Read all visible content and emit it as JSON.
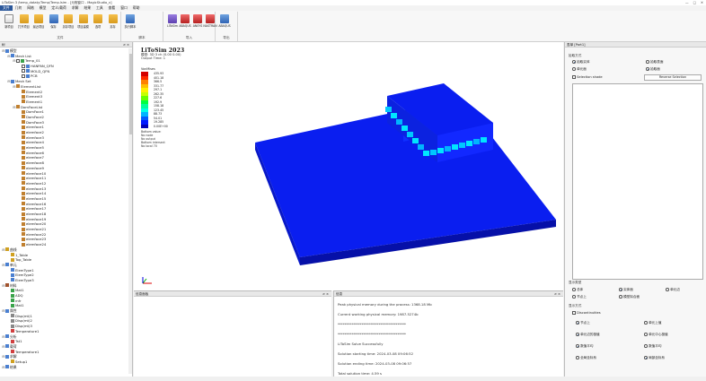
{
  "window": {
    "title": "LiToSim 3 /temp_dataty/Temp/Temp.lsim - [元程窗口 - MagicStudio_v]"
  },
  "menu": [
    "文件",
    "几何",
    "网格",
    "模型",
    "定义/载荷",
    "求解",
    "结果",
    "工具",
    "查看",
    "窗口",
    "帮助"
  ],
  "ribbon": {
    "groups": [
      {
        "label": "文件",
        "buttons": [
          "新项目",
          "打开项目",
          "最近项目",
          "保存",
          "另存项目",
          "项目建模",
          "选项",
          "另存"
        ]
      },
      {
        "label": "脚本",
        "buttons": [
          "执行脚本"
        ]
      },
      {
        "label": "导入",
        "buttons": [
          "LiToSim",
          "ABAQUS",
          "ANSYS",
          "NASTRAN"
        ]
      },
      {
        "label": "导出",
        "buttons": [
          "ABAQUS"
        ]
      }
    ]
  },
  "left_panel": {
    "title": "树",
    "pin": "≠ ×"
  },
  "tree": [
    {
      "d": 0,
      "t": "模型",
      "tw": "⊟",
      "icon": "#4a7fd0"
    },
    {
      "d": 1,
      "t": "Mesh List",
      "tw": "⊟",
      "icon": "#4a7fd0"
    },
    {
      "d": 2,
      "t": "Temp_01",
      "tw": "⊟",
      "icon": "#3aa34a",
      "chk": true
    },
    {
      "d": 3,
      "t": "HANPAN_QFN",
      "tw": "",
      "icon": "#4a7fd0",
      "chk": true
    },
    {
      "d": 3,
      "t": "MOLD_QFN",
      "tw": "",
      "icon": "#4a7fd0",
      "chk": true
    },
    {
      "d": 3,
      "t": "PCB",
      "tw": "",
      "icon": "#4a7fd0",
      "chk": true
    },
    {
      "d": 1,
      "t": "Mesh Set",
      "tw": "⊟",
      "icon": "#4a7fd0"
    },
    {
      "d": 2,
      "t": "ElementList",
      "tw": "⊟",
      "icon": "#c08030"
    },
    {
      "d": 3,
      "t": "Element2",
      "tw": "",
      "icon": "#c08030"
    },
    {
      "d": 3,
      "t": "Element3",
      "tw": "",
      "icon": "#c08030"
    },
    {
      "d": 3,
      "t": "Element1",
      "tw": "",
      "icon": "#c08030"
    },
    {
      "d": 2,
      "t": "DomFaceList",
      "tw": "⊟",
      "icon": "#c08030"
    },
    {
      "d": 3,
      "t": "DomFace1",
      "tw": "",
      "icon": "#c08030"
    },
    {
      "d": 3,
      "t": "DomFace2",
      "tw": "",
      "icon": "#c08030"
    },
    {
      "d": 3,
      "t": "DomFace3",
      "tw": "",
      "icon": "#c08030"
    },
    {
      "d": 3,
      "t": "elemface1",
      "tw": "",
      "icon": "#c08030"
    },
    {
      "d": 3,
      "t": "elemface2",
      "tw": "",
      "icon": "#c08030"
    },
    {
      "d": 3,
      "t": "elemface3",
      "tw": "",
      "icon": "#c08030"
    },
    {
      "d": 3,
      "t": "elemface4",
      "tw": "",
      "icon": "#c08030"
    },
    {
      "d": 3,
      "t": "elemface5",
      "tw": "",
      "icon": "#c08030"
    },
    {
      "d": 3,
      "t": "elemface6",
      "tw": "",
      "icon": "#c08030"
    },
    {
      "d": 3,
      "t": "elemface7",
      "tw": "",
      "icon": "#c08030"
    },
    {
      "d": 3,
      "t": "elemface8",
      "tw": "",
      "icon": "#c08030"
    },
    {
      "d": 3,
      "t": "elemface9",
      "tw": "",
      "icon": "#c08030"
    },
    {
      "d": 3,
      "t": "elemface10",
      "tw": "",
      "icon": "#c08030"
    },
    {
      "d": 3,
      "t": "elemface11",
      "tw": "",
      "icon": "#c08030"
    },
    {
      "d": 3,
      "t": "elemface12",
      "tw": "",
      "icon": "#c08030"
    },
    {
      "d": 3,
      "t": "elemface13",
      "tw": "",
      "icon": "#c08030"
    },
    {
      "d": 3,
      "t": "elemface14",
      "tw": "",
      "icon": "#c08030"
    },
    {
      "d": 3,
      "t": "elemface15",
      "tw": "",
      "icon": "#c08030"
    },
    {
      "d": 3,
      "t": "elemface16",
      "tw": "",
      "icon": "#c08030"
    },
    {
      "d": 3,
      "t": "elemface17",
      "tw": "",
      "icon": "#c08030"
    },
    {
      "d": 3,
      "t": "elemface18",
      "tw": "",
      "icon": "#c08030"
    },
    {
      "d": 3,
      "t": "elemface19",
      "tw": "",
      "icon": "#c08030"
    },
    {
      "d": 3,
      "t": "elemface20",
      "tw": "",
      "icon": "#c08030"
    },
    {
      "d": 3,
      "t": "elemface21",
      "tw": "",
      "icon": "#c08030"
    },
    {
      "d": 3,
      "t": "elemface22",
      "tw": "",
      "icon": "#c08030"
    },
    {
      "d": 3,
      "t": "elemface23",
      "tw": "",
      "icon": "#c08030"
    },
    {
      "d": 3,
      "t": "elemface24",
      "tw": "",
      "icon": "#c08030"
    },
    {
      "d": 0,
      "t": "曲线",
      "tw": "⊟",
      "icon": "#d0a020"
    },
    {
      "d": 1,
      "t": "1_Table",
      "tw": "",
      "icon": "#d0a020"
    },
    {
      "d": 1,
      "t": "Top_Table",
      "tw": "",
      "icon": "#d0a020"
    },
    {
      "d": 0,
      "t": "单元",
      "tw": "⊟",
      "icon": "#4a7fd0"
    },
    {
      "d": 1,
      "t": "ElemType1",
      "tw": "",
      "icon": "#4a7fd0"
    },
    {
      "d": 1,
      "t": "ElemType2",
      "tw": "",
      "icon": "#4a7fd0"
    },
    {
      "d": 1,
      "t": "ElemType3",
      "tw": "",
      "icon": "#4a7fd0"
    },
    {
      "d": 0,
      "t": "材料",
      "tw": "⊟",
      "icon": "#a0522d"
    },
    {
      "d": 1,
      "t": "Mat1",
      "tw": "",
      "icon": "#3aa34a"
    },
    {
      "d": 1,
      "t": "ADQ",
      "tw": "",
      "icon": "#3aa34a"
    },
    {
      "d": 1,
      "t": "mfr",
      "tw": "",
      "icon": "#3aa34a"
    },
    {
      "d": 1,
      "t": "Mat1",
      "tw": "",
      "icon": "#3aa34a"
    },
    {
      "d": 0,
      "t": "属性",
      "tw": "⊟",
      "icon": "#4a7fd0"
    },
    {
      "d": 1,
      "t": "Disp(mt)1",
      "tw": "",
      "icon": "#888"
    },
    {
      "d": 1,
      "t": "Disp(mt)2",
      "tw": "",
      "icon": "#888"
    },
    {
      "d": 1,
      "t": "Disp(mt)3",
      "tw": "",
      "icon": "#888"
    },
    {
      "d": 1,
      "t": "Temperature1",
      "tw": "",
      "icon": "#d04040"
    },
    {
      "d": 0,
      "t": "分析",
      "tw": "⊟",
      "icon": "#4a7fd0"
    },
    {
      "d": 1,
      "t": "Tst1",
      "tw": "",
      "icon": "#d04040"
    },
    {
      "d": 0,
      "t": "载荷",
      "tw": "⊟",
      "icon": "#4a7fd0"
    },
    {
      "d": 1,
      "t": "Temperature1",
      "tw": "",
      "icon": "#d04040"
    },
    {
      "d": 0,
      "t": "求解",
      "tw": "⊟",
      "icon": "#4a7fd0"
    },
    {
      "d": 1,
      "t": "Setup1",
      "tw": "",
      "icon": "#d0a020"
    },
    {
      "d": 0,
      "t": "结果",
      "tw": "⊟",
      "icon": "#4a7fd0"
    }
  ],
  "viewport": {
    "brand": "LiToSim 2023",
    "info": [
      "模型: 3D 3 ch (0.00 0.00)",
      "Output     Time: 1"
    ],
    "legend_title": "VonMises",
    "legend_values": [
      "435.93",
      "401.18",
      "366.5",
      "331.77",
      "297.1",
      "262.35",
      "227.6",
      "192.9",
      "158.18",
      "123.45",
      "88.73",
      "54.01",
      "19.285",
      "0.00E+00"
    ],
    "legend_extra": [
      "Bottom value:",
      "No node",
      "No output",
      "Bottom intersect",
      "No local 70"
    ],
    "colors": [
      "#d40000",
      "#ff2a00",
      "#ff8000",
      "#ffbf00",
      "#fff000",
      "#c6ff00",
      "#6aff00",
      "#00ff40",
      "#00ff9a",
      "#00ffe6",
      "#00b4ff",
      "#005cff",
      "#0018ff",
      "#0000b8"
    ]
  },
  "panels": {
    "bottom_left_title": "信息面板",
    "bottom_mid_title": "信息",
    "log": [
      "Peak physical memory during the process: 1368.18 Mb",
      "Current working physical memory: 1987.5274b",
      "****************************************",
      "****************************************",
      "LiToSim Solve Successfully",
      "Solution starting time: 2024-03-08 09:06:52",
      "Solution ending time: 2024-03-08 09:06:57",
      "Total solution time: 4.59 s"
    ]
  },
  "right_panel": {
    "title": "表单 [Part1]",
    "section1": "拾取方式",
    "opts1": [
      "拾取实体",
      "拾取表面",
      "单元面",
      "拾取面",
      "Selection shade"
    ],
    "reverse_btn": "Reverse Selection",
    "section2": "显示类型",
    "opts2": [
      "总体",
      "实体面",
      "单元边",
      "节点上",
      "模型拟合面"
    ],
    "section3": "显示方式",
    "disc": "Discontinuities",
    "opts3": [
      "节点上",
      "单元上值",
      "单元边的极值",
      "单元中心极值",
      "数值平均",
      "数值平均",
      "全局坐标系",
      "局部坐标系"
    ]
  }
}
